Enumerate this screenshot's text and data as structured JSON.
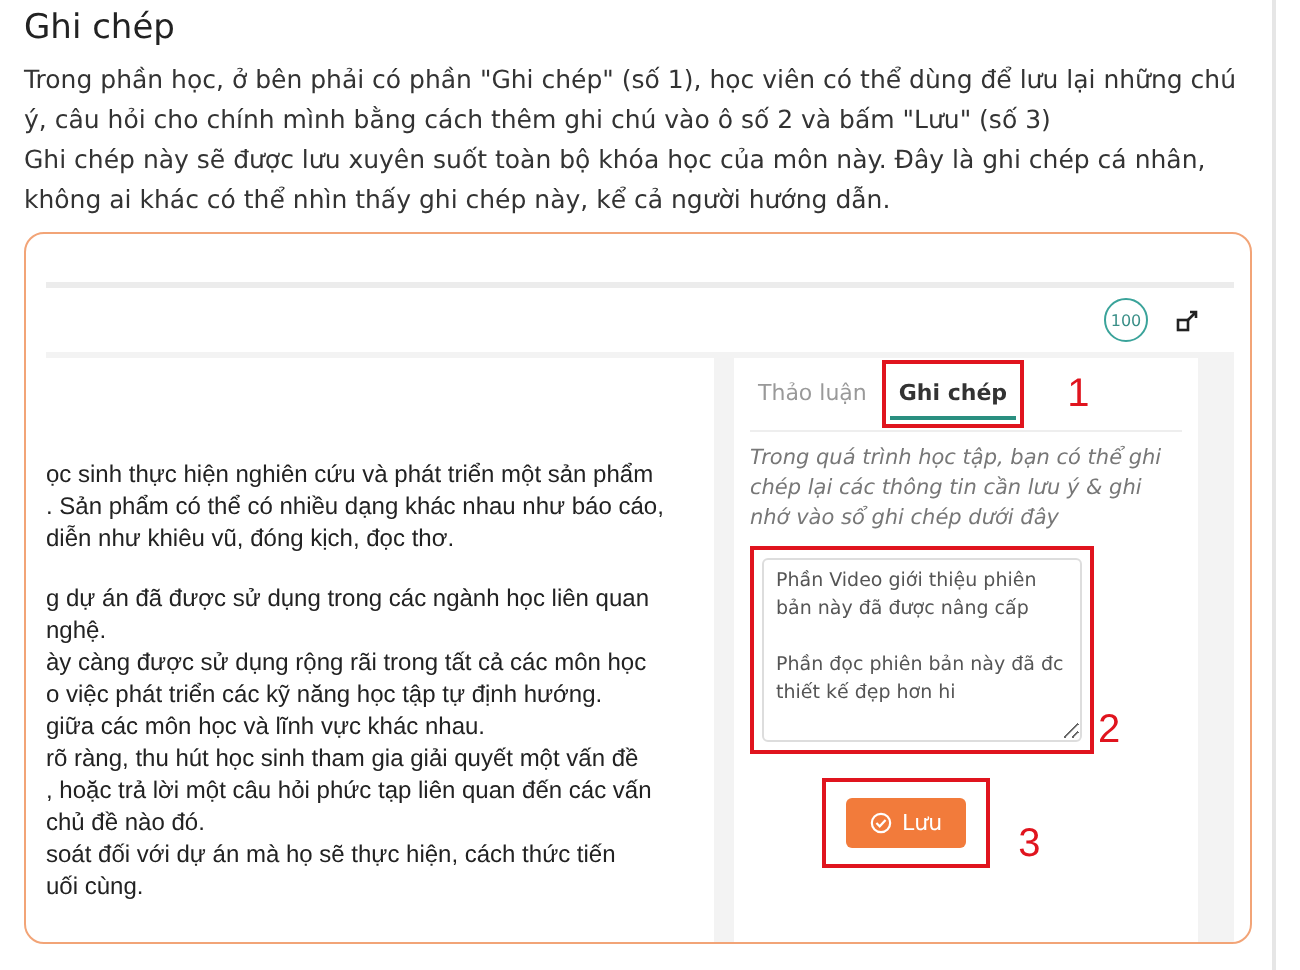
{
  "heading": "Ghi chép",
  "intro": [
    "Trong phần học, ở bên phải có phần \"Ghi chép\" (số 1), học viên có thể dùng để lưu lại những chú ý, câu hỏi cho chính mình bằng cách thêm ghi chú vào ô số 2 và bấm \"Lưu\" (số 3)",
    "Ghi chép này sẽ được lưu xuyên suốt toàn bộ khóa học của môn này. Đây là ghi chép cá nhân, không ai khác có thể nhìn thấy ghi chép này, kể cả người hướng dẫn."
  ],
  "screenshot": {
    "score": "100",
    "lesson_paragraphs": [
      [
        "ọc sinh thực hiện nghiên cứu và phát triển một sản phẩm",
        ". Sản phẩm có thể có nhiều dạng khác nhau như báo cáo,",
        "diễn như khiêu vũ, đóng kịch, đọc thơ."
      ],
      [
        "g dự án đã được sử dụng trong các ngành học liên quan",
        "nghệ.",
        "ày càng được sử dụng rộng rãi trong tất cả các môn học",
        "o việc phát triển các kỹ năng học tập tự định hướng.",
        "giữa các môn học và lĩnh vực khác nhau.",
        "rõ ràng, thu hút học sinh tham gia giải quyết một vấn đề",
        ", hoặc trả lời một câu hỏi phức tạp liên quan đến các vấn",
        "chủ đề nào đó.",
        "soát đối với dự án mà họ sẽ thực hiện, cách thức tiến",
        "uối cùng."
      ]
    ],
    "tabs": [
      {
        "label": "Thảo luận",
        "selected": false
      },
      {
        "label": "Ghi chép",
        "selected": true
      }
    ],
    "notes_hint": "Trong quá trình học tập, bạn có thể ghi chép lại các thông tin cần lưu ý & ghi nhớ vào sổ ghi chép dưới đây",
    "note_value": "Phần Video giới thiệu phiên bản này đã được nâng cấp\n\nPhần đọc phiên bản này đã đc thiết kế đẹp hơn hi",
    "save_button": "Lưu"
  },
  "markers": [
    "1",
    "2",
    "3"
  ]
}
